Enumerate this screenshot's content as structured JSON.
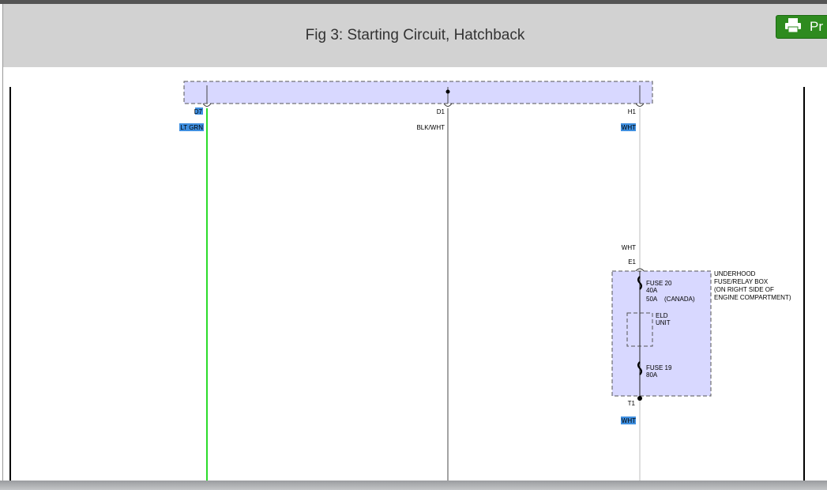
{
  "header": {
    "title": "Fig 3: Starting Circuit, Hatchback"
  },
  "toolbar": {
    "print_label": "Pr",
    "print_icon": "printer-icon"
  },
  "colors": {
    "header_bg": "#d2d2d2",
    "print_button": "#2e8b1f",
    "component_fill": "#d8d8ff",
    "wire_lt_grn": "#2bdc2b",
    "highlight": "#3f8fe0"
  },
  "diagram": {
    "connectors": {
      "d7": "D7",
      "d1": "D1",
      "h1": "H1",
      "e1": "E1",
      "t1": "T1"
    },
    "wires": {
      "lt_grn": "LT GRN",
      "blk_wht": "BLK/WHT",
      "wht_top": "WHT",
      "wht_mid": "WHT",
      "wht_bottom": "WHT"
    },
    "fuse_box": {
      "line1": "UNDERHOOD",
      "line2": "FUSE/RELAY BOX",
      "line3": "(ON RIGHT SIDE OF",
      "line4": "ENGINE COMPARTMENT)"
    },
    "fuse20": {
      "name": "FUSE 20",
      "rating": "40A",
      "rating_alt": "50A",
      "note": "(CANADA)"
    },
    "eld": {
      "line1": "ELD",
      "line2": "UNIT"
    },
    "fuse19": {
      "name": "FUSE 19",
      "rating": "80A"
    }
  }
}
